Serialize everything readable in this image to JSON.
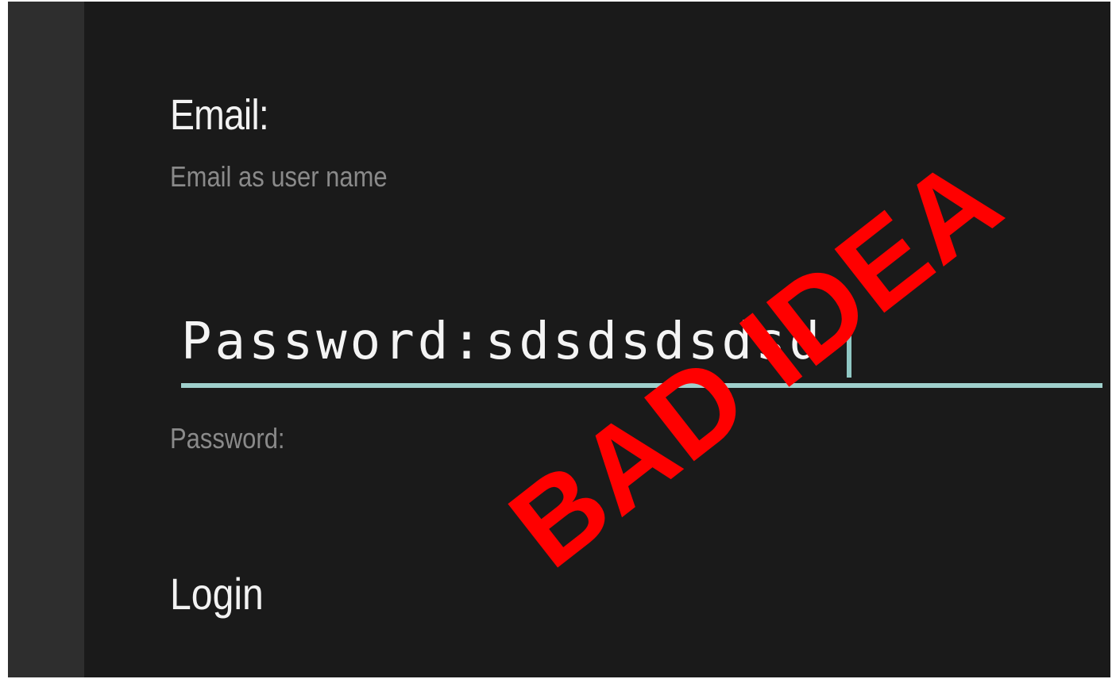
{
  "form": {
    "email_label": "Email:",
    "email_hint": "Email as user name",
    "password_value": "Password:sdsdsdsdsd",
    "password_hint": "Password:",
    "login_label": "Login"
  },
  "overlay": {
    "stamp_text": "BAD IDEA"
  },
  "colors": {
    "background": "#1a1a1a",
    "sidebar": "#2e2e2e",
    "accent": "#a0d0cc",
    "stamp": "#ff0000",
    "hint": "#8a8a8a"
  }
}
